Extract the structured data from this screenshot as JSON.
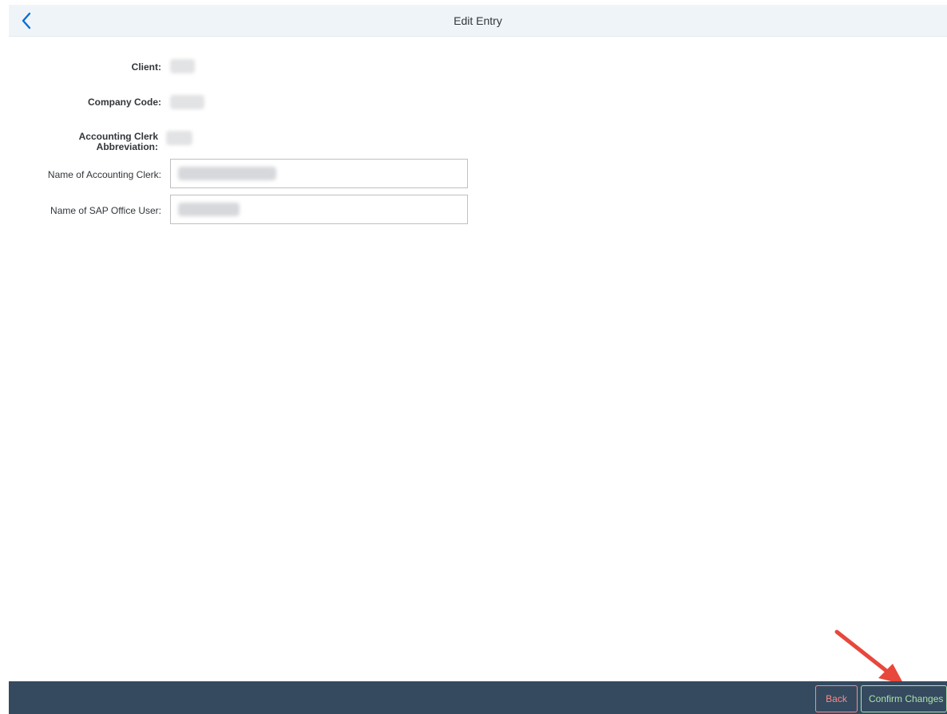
{
  "header": {
    "title": "Edit Entry",
    "back_icon": "chevron-left-icon"
  },
  "form": {
    "client_label": "Client:",
    "company_code_label": "Company Code:",
    "clerk_abbrev_label_line1": "Accounting Clerk",
    "clerk_abbrev_label_line2": "Abbreviation:",
    "clerk_name_label": "Name of Accounting Clerk:",
    "office_user_label": "Name of SAP Office User:"
  },
  "footer": {
    "back_label": "Back",
    "confirm_label": "Confirm Changes"
  },
  "colors": {
    "header_bg": "#eff4f9",
    "footer_bg": "#354a5f",
    "back_button": "#ff8888",
    "confirm_button": "#abe2ab",
    "annotation_arrow": "#e8473c",
    "back_icon": "#0a6ed1"
  }
}
